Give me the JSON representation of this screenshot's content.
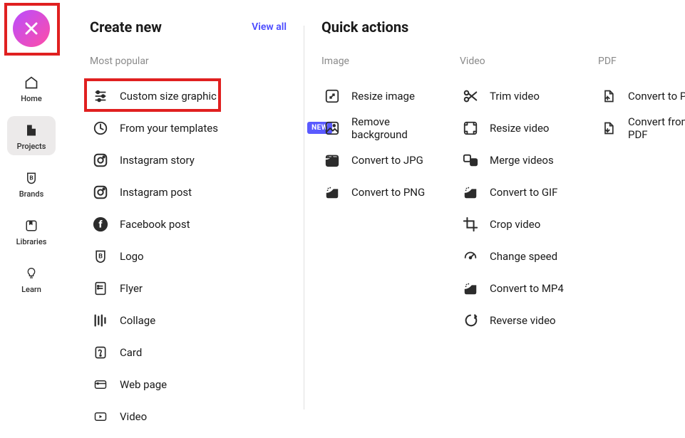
{
  "sidebar": {
    "nav": [
      {
        "label": "Home"
      },
      {
        "label": "Projects"
      },
      {
        "label": "Brands"
      },
      {
        "label": "Libraries"
      },
      {
        "label": "Learn"
      }
    ]
  },
  "create": {
    "heading": "Create new",
    "view_all": "View all",
    "subheader": "Most popular",
    "badge_new": "NEW",
    "items": [
      {
        "label": "Custom size graphic",
        "highlight": true
      },
      {
        "label": "From your templates",
        "badge_new": true
      },
      {
        "label": "Instagram story"
      },
      {
        "label": "Instagram post"
      },
      {
        "label": "Facebook post"
      },
      {
        "label": "Logo"
      },
      {
        "label": "Flyer"
      },
      {
        "label": "Collage"
      },
      {
        "label": "Card"
      },
      {
        "label": "Web page"
      },
      {
        "label": "Video"
      }
    ]
  },
  "quick": {
    "heading": "Quick actions",
    "cols": [
      {
        "header": "Image",
        "items": [
          {
            "label": "Resize image"
          },
          {
            "label": "Remove background"
          },
          {
            "label": "Convert to JPG"
          },
          {
            "label": "Convert to PNG"
          }
        ]
      },
      {
        "header": "Video",
        "items": [
          {
            "label": "Trim video"
          },
          {
            "label": "Resize video"
          },
          {
            "label": "Merge videos"
          },
          {
            "label": "Convert to GIF"
          },
          {
            "label": "Crop video"
          },
          {
            "label": "Change speed"
          },
          {
            "label": "Convert to MP4"
          },
          {
            "label": "Reverse video"
          }
        ]
      },
      {
        "header": "PDF",
        "items": [
          {
            "label": "Convert to PDF"
          },
          {
            "label": "Convert from PDF"
          }
        ]
      }
    ]
  }
}
